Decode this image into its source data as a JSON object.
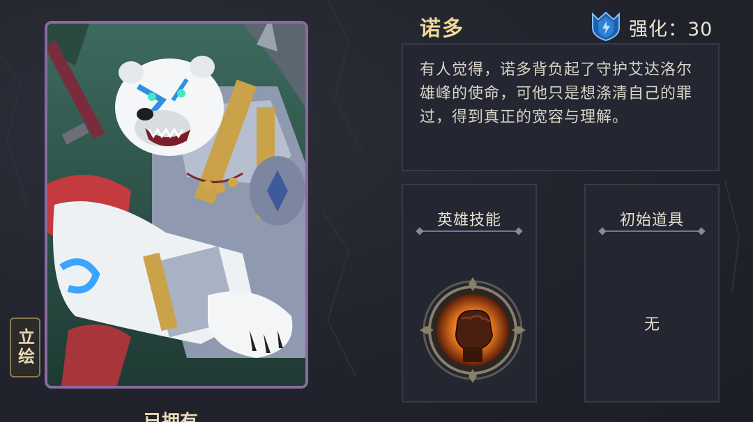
{
  "hero": {
    "name": "诺多",
    "enhance_text": "强化：30",
    "description": "有人觉得，诺多背负起了守护艾达洛尔雄峰的使命，可他只是想涤清自己的罪过，得到真正的宽容与理解。",
    "portrait_tab_label": "立绘",
    "owned_label": "已拥有"
  },
  "skill_panel": {
    "title": "英雄技能",
    "icon": "fist-skill-icon"
  },
  "item_panel": {
    "title": "初始道具",
    "empty_text": "无"
  },
  "colors": {
    "name_gold": "#f3d79a",
    "panel_border": "#373b48",
    "portrait_border": "#8a6aa0",
    "enhance_badge": "#2e7fd6"
  }
}
